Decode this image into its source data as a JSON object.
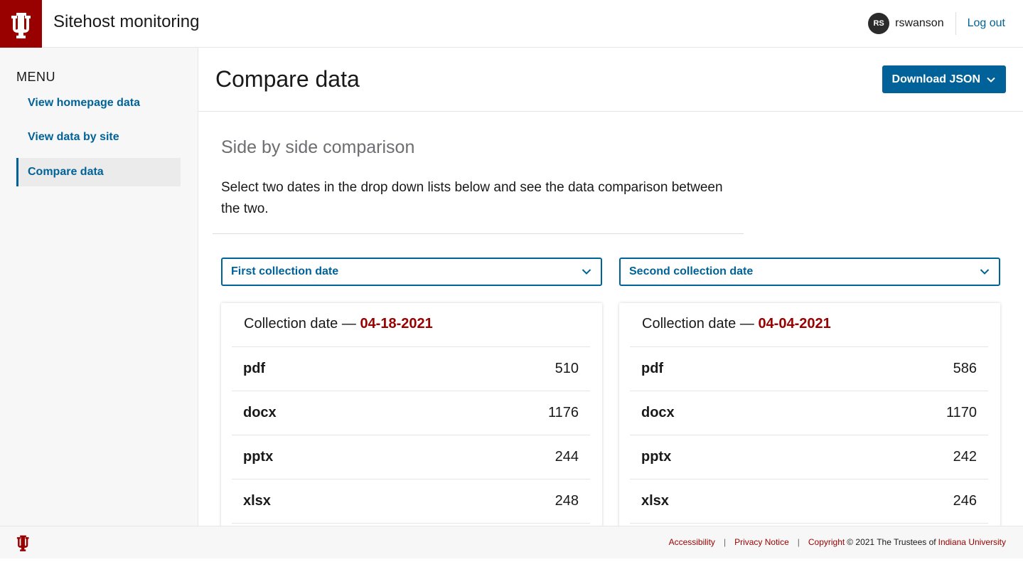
{
  "header": {
    "site_title": "Sitehost monitoring",
    "user_initials": "RS",
    "username": "rswanson",
    "logout_label": "Log out",
    "brand_color": "#990000",
    "logo_icon": "iu-trident-icon"
  },
  "sidebar": {
    "menu_label": "MENU",
    "items": [
      {
        "label": "View homepage data",
        "active": false
      },
      {
        "label": "View data by site",
        "active": false
      },
      {
        "label": "Compare data",
        "active": true
      }
    ]
  },
  "page": {
    "title": "Compare data",
    "download_label": "Download JSON"
  },
  "section": {
    "title": "Side by side comparison",
    "description": "Select two dates in the drop down lists below and see the data comparison between the two."
  },
  "selects": {
    "first": "First collection date",
    "second": "Second collection date"
  },
  "cards": [
    {
      "head_label": "Collection date —",
      "date": "04-18-2021",
      "rows": [
        {
          "key": "pdf",
          "value": "510"
        },
        {
          "key": "docx",
          "value": "1176"
        },
        {
          "key": "pptx",
          "value": "244"
        },
        {
          "key": "xlsx",
          "value": "248"
        }
      ]
    },
    {
      "head_label": "Collection date —",
      "date": "04-04-2021",
      "rows": [
        {
          "key": "pdf",
          "value": "586"
        },
        {
          "key": "docx",
          "value": "1170"
        },
        {
          "key": "pptx",
          "value": "242"
        },
        {
          "key": "xlsx",
          "value": "246"
        }
      ]
    }
  ],
  "footer": {
    "accessibility": "Accessibility",
    "privacy": "Privacy Notice",
    "copyright_link": "Copyright",
    "copyright_text": "© 2021 The Trustees of",
    "university": "Indiana University",
    "separator": "|"
  }
}
